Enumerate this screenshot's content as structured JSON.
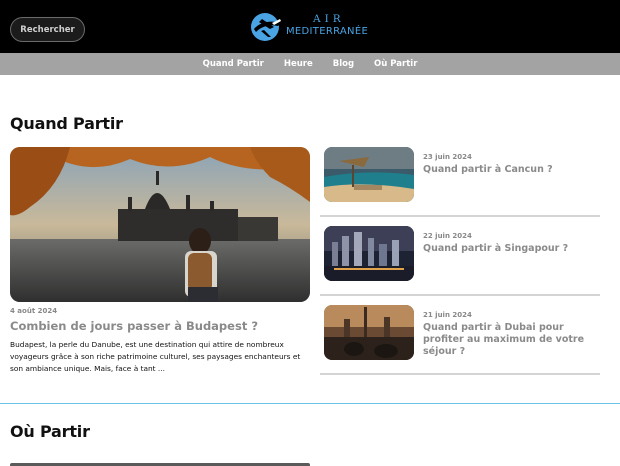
{
  "header": {
    "search_label": "Rechercher",
    "logo_line1": "AIR",
    "logo_line2": "MEDITERRANÉE",
    "brand_color": "#4aa3e3"
  },
  "nav": {
    "items": [
      {
        "label": "Quand Partir"
      },
      {
        "label": "Heure"
      },
      {
        "label": "Blog"
      },
      {
        "label": "Où Partir"
      }
    ]
  },
  "section1": {
    "title": "Quand Partir",
    "featured": {
      "date": "4 août 2024",
      "title": "Combien de jours passer à Budapest ?",
      "excerpt": "Budapest, la perle du Danube, est une destination qui attire de nombreux voyageurs grâce à son riche patrimoine culturel, ses paysages enchanteurs et son ambiance unique. Mais, face à tant ..."
    },
    "side_articles": [
      {
        "date": "23 juin 2024",
        "title": "Quand partir à Cancun ?"
      },
      {
        "date": "22 juin 2024",
        "title": "Quand partir à Singapour ?"
      },
      {
        "date": "21 juin 2024",
        "title": "Quand partir à Dubai pour profiter au maximum de votre séjour ?"
      }
    ]
  },
  "section2": {
    "title": "Où Partir"
  }
}
